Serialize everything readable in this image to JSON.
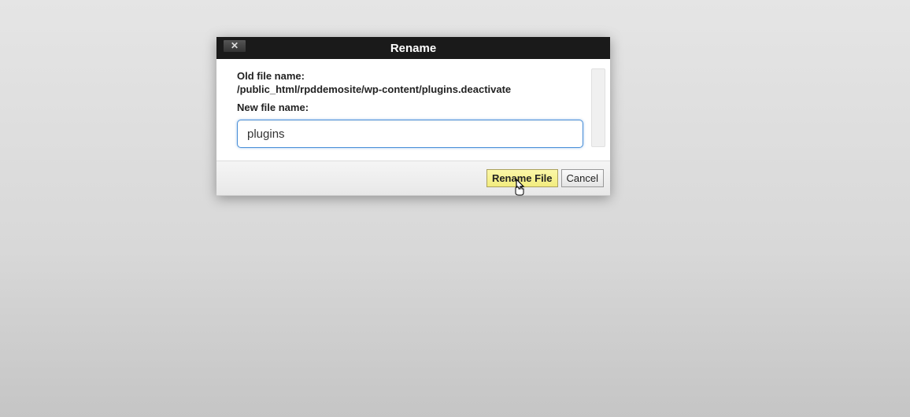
{
  "dialog": {
    "title": "Rename",
    "old_name_label": "Old file name:",
    "old_name_path": "/public_html/rpddemosite/wp-content/plugins.deactivate",
    "new_name_label": "New file name:",
    "new_name_value": "plugins",
    "primary_button": "Rename File",
    "cancel_button": "Cancel",
    "close_glyph": "✕"
  }
}
